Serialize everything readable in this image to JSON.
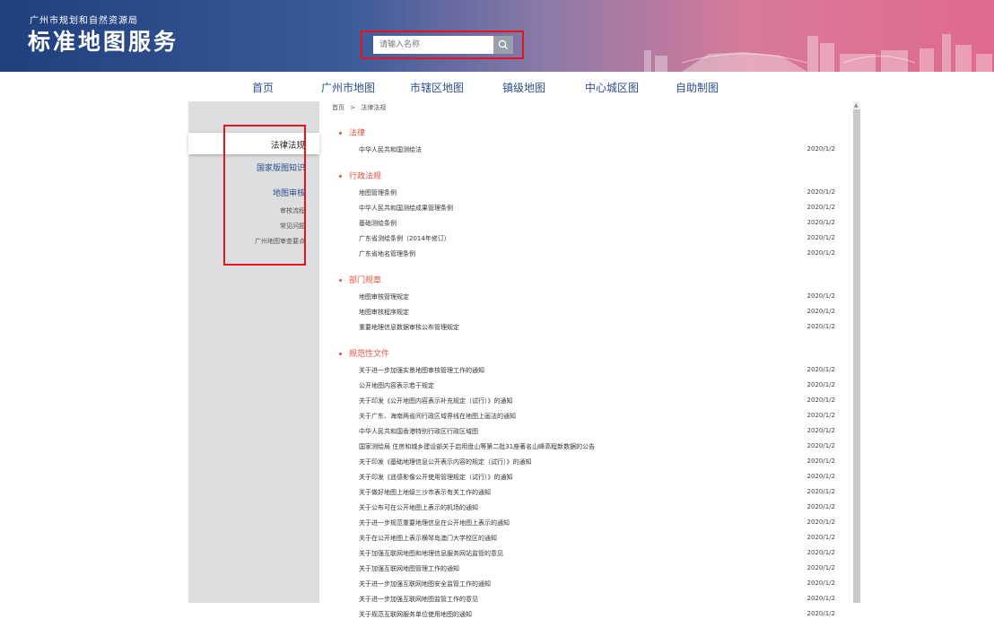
{
  "header": {
    "org": "广州市规划和自然资源局",
    "title": "标准地图服务"
  },
  "search": {
    "placeholder": "请输入名称"
  },
  "nav": [
    "首页",
    "广州市地图",
    "市辖区地图",
    "镇级地图",
    "中心城区图",
    "自助制图"
  ],
  "breadcrumb": {
    "home": "首页",
    "sep": ">",
    "current": "法律法规"
  },
  "sidebar": {
    "items": [
      "法律法规",
      "国家版图知识",
      "地图审核",
      "审核流程",
      "常见问题",
      "广州地图审查要点"
    ]
  },
  "sections": [
    {
      "title": "法律",
      "rows": [
        {
          "name": "中华人民共和国测绘法",
          "date": "2020/1/2"
        }
      ]
    },
    {
      "title": "行政法规",
      "rows": [
        {
          "name": "地图管理条例",
          "date": "2020/1/2"
        },
        {
          "name": "中华人民共和国测绘成果管理条例",
          "date": "2020/1/2"
        },
        {
          "name": "基础测绘条例",
          "date": "2020/1/2"
        },
        {
          "name": "广东省测绘条例（2014年修订）",
          "date": "2020/1/2"
        },
        {
          "name": "广东省地名管理条例",
          "date": "2020/1/2"
        }
      ]
    },
    {
      "title": "部门规章",
      "rows": [
        {
          "name": "地图审核管理规定",
          "date": "2020/1/2"
        },
        {
          "name": "地图审核程序规定",
          "date": "2020/1/2"
        },
        {
          "name": "重要地理信息数据审核公布管理规定",
          "date": "2020/1/2"
        }
      ]
    },
    {
      "title": "规范性文件",
      "rows": [
        {
          "name": "关于进一步加强实景地图审核管理工作的通知",
          "date": "2020/1/2"
        },
        {
          "name": "公开地图内容表示若干规定",
          "date": "2020/1/2"
        },
        {
          "name": "关于印发《公开地图内容表示补充规定（试行）》的通知",
          "date": "2020/1/2"
        },
        {
          "name": "关于广东、海南两省间行政区域界线在地图上画法的通知",
          "date": "2020/1/2"
        },
        {
          "name": "中华人民共和国香港特别行政区行政区域图",
          "date": "2020/1/2"
        },
        {
          "name": "国家测绘局 住房和城乡建设部关于启用盘山等第二批31座著名山峰高程新数据的公告",
          "date": "2020/1/2"
        },
        {
          "name": "关于印发《基础地理信息公开表示内容的规定（试行）》的通知",
          "date": "2020/1/2"
        },
        {
          "name": "关于印发《遥感影像公开使用管理规定（试行）》的通知",
          "date": "2020/1/2"
        },
        {
          "name": "关于做好地图上地级三沙市表示有关工作的通知",
          "date": "2020/1/2"
        },
        {
          "name": "关于公布可在公开地图上表示的机场的通知",
          "date": "2020/1/2"
        },
        {
          "name": "关于进一步规范重要地理信息在公开地图上表示的通知",
          "date": "2020/1/2"
        },
        {
          "name": "关于在公开地图上表示横琴岛澳门大学校区的通知",
          "date": "2020/1/2"
        },
        {
          "name": "关于加强互联网地图和地理信息服务网站监管的意见",
          "date": "2020/1/2"
        },
        {
          "name": "关于加强互联网地图管理工作的通知",
          "date": "2020/1/2"
        },
        {
          "name": "关于进一步加强互联网地图安全监管工作的通知",
          "date": "2020/1/2"
        },
        {
          "name": "关于进一步加强互联网地图监管工作的意见",
          "date": "2020/1/2"
        },
        {
          "name": "关于规范互联网服务单位使用地图的通知",
          "date": "2020/1/2"
        }
      ]
    }
  ],
  "colors": {
    "accent_red": "#e0533f",
    "nav_blue": "#2e4f8f",
    "highlight_box": "#e3161b"
  }
}
